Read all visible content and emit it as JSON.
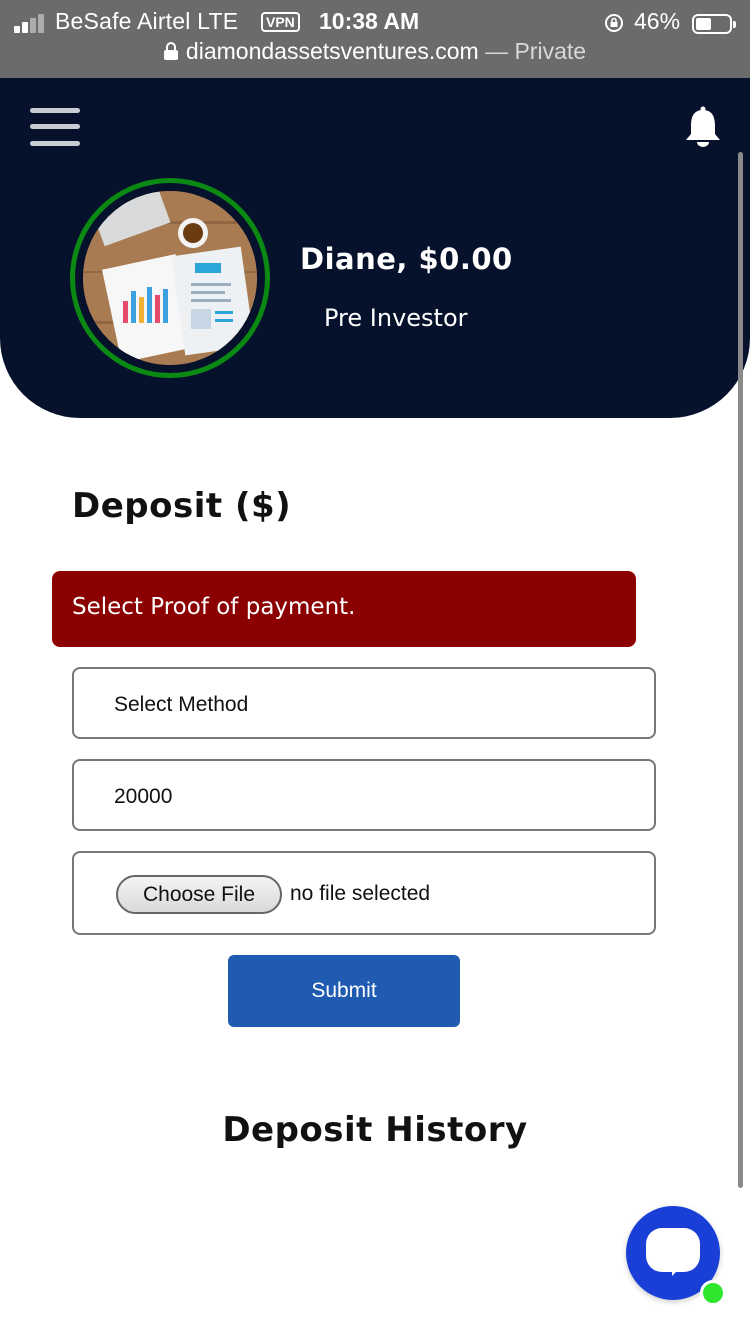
{
  "status_bar": {
    "carrier": "BeSafe Airtel  LTE",
    "vpn_badge": "VPN",
    "time": "10:38 AM",
    "battery_percent": "46%",
    "battery_level": 0.46,
    "signal_bars_active": 2
  },
  "address_bar": {
    "host": "diamondassetsventures.com",
    "separator": " — ",
    "mode": "Private"
  },
  "header": {
    "background_color": "#06122b",
    "avatar_ring_color": "#0b8a13",
    "user_line": "Diane, $0.00",
    "role": "Pre Investor",
    "icons": {
      "menu": "hamburger-menu-icon",
      "notifications": "bell-icon"
    }
  },
  "deposit": {
    "title": "Deposit ($)",
    "alert_text": "Select Proof of payment.",
    "alert_color": "#8b0000",
    "method_value": "Select Method",
    "amount_value": "20000",
    "file_button_label": "Choose File",
    "file_status": "no file selected",
    "submit_label": "Submit",
    "submit_color": "#1f5bb0"
  },
  "history": {
    "title": "Deposit History"
  },
  "chat_widget": {
    "icon": "chat-bubble-icon",
    "status": "online",
    "color": "#1a3fd6"
  }
}
